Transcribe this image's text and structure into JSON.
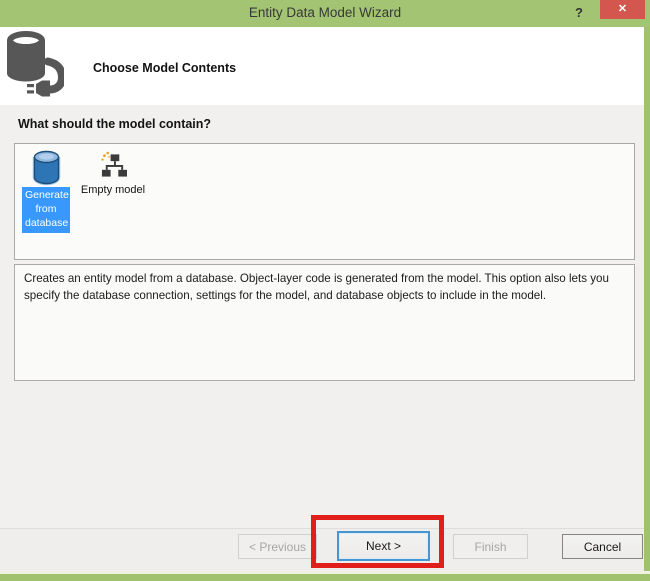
{
  "window": {
    "title": "Entity Data Model Wizard",
    "help_label": "?",
    "close_label": "✕"
  },
  "header": {
    "title": "Choose Model Contents",
    "icon": "database-plug-icon"
  },
  "main": {
    "question_label": "What should the model contain?",
    "options": [
      {
        "id": "generate-from-database",
        "icon": "database-icon",
        "label": "Generate from database",
        "label_lines": [
          "Generate",
          "from",
          "database"
        ],
        "selected": true
      },
      {
        "id": "empty-model",
        "icon": "empty-model-icon",
        "label": "Empty model",
        "selected": false
      }
    ],
    "description": "Creates an entity model from a database. Object-layer code is generated from the model. This option also lets you specify the database connection, settings for the model, and database objects to include in the model."
  },
  "footer": {
    "buttons": [
      {
        "label": "< Previous",
        "enabled": false
      },
      {
        "label": "Next >",
        "enabled": true,
        "is_default": true,
        "highlighted_by_annotation": true
      },
      {
        "label": "Finish",
        "enabled": false
      },
      {
        "label": "Cancel",
        "enabled": true
      }
    ]
  },
  "colors": {
    "titlebar_green": "#A3C573",
    "close_button_red": "#D3564F",
    "selection_blue": "#3898FE",
    "annotation_red": "#E01E1A"
  }
}
